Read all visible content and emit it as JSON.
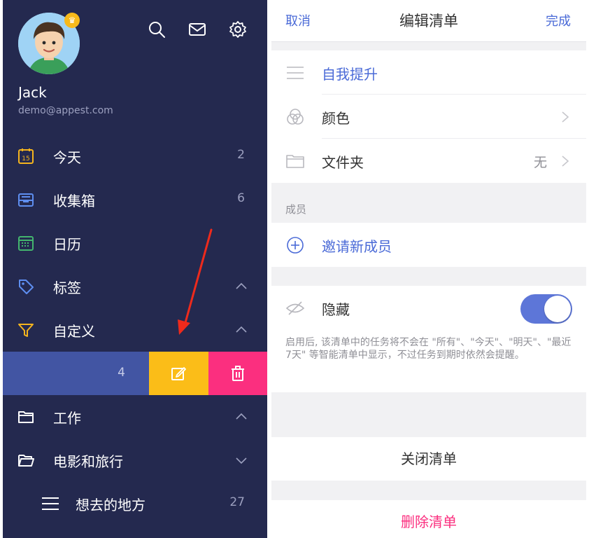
{
  "colors": {
    "sidebar_bg": "#24294f",
    "accent_blue": "#4a6ad7",
    "swipe_selected": "#4255a3",
    "swipe_edit": "#fbbd18",
    "swipe_delete": "#fb2f7f",
    "annotation_arrow": "#ee2a1c"
  },
  "sidebar": {
    "user": {
      "name": "Jack",
      "email": "demo@appest.com",
      "avatar_icon": "avatar-icon",
      "badge_icon": "crown-icon"
    },
    "top_icons": [
      "search-icon",
      "mail-icon",
      "gear-icon"
    ],
    "items": [
      {
        "label": "今天",
        "count": "2",
        "icon": "calendar-15-icon"
      },
      {
        "label": "收集箱",
        "count": "6",
        "icon": "inbox-icon"
      },
      {
        "label": "日历",
        "count": "",
        "icon": "calendar-grid-icon"
      },
      {
        "label": "标签",
        "count": "",
        "icon": "tag-icon",
        "expanded": true
      },
      {
        "label": "自定义",
        "count": "",
        "icon": "filter-icon",
        "expanded": true
      }
    ],
    "swiped_row": {
      "count": "4",
      "actions": [
        "edit-icon",
        "trash-icon"
      ]
    },
    "folders": [
      {
        "label": "工作",
        "icon": "folder-icon",
        "expanded": true
      },
      {
        "label": "电影和旅行",
        "icon": "folder-open-icon",
        "expanded": false
      }
    ],
    "sub_item": {
      "label": "想去的地方",
      "count": "27",
      "icon": "list-icon"
    }
  },
  "panel": {
    "cancel_label": "取消",
    "title": "编辑清单",
    "done_label": "完成",
    "list_name": "自我提升",
    "color_label": "颜色",
    "folder_label": "文件夹",
    "folder_value": "无",
    "members_header": "成员",
    "invite_label": "邀请新成员",
    "hide_label": "隐藏",
    "hide_enabled": true,
    "hide_hint": "启用后, 该清单中的任务将不会在 \"所有\"、\"今天\"、\"明天\"、\"最近7天\" 等智能清单中显示，不过任务到期时依然会提醒。",
    "close_list_label": "关闭清单",
    "delete_list_label": "删除清单"
  }
}
